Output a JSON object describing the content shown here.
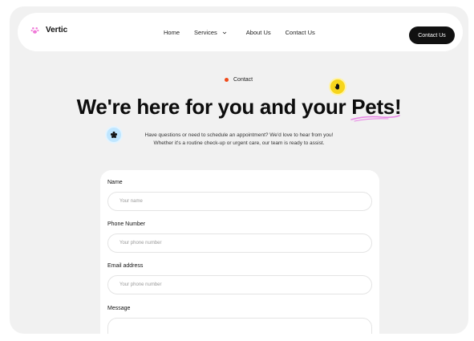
{
  "nav": {
    "brand": "Vertic",
    "links": [
      "Home",
      "Services",
      "About Us",
      "Contact Us"
    ],
    "cta_label": "Contact Us"
  },
  "hero": {
    "eyebrow": "Contact",
    "headline_before": "We're here for you and your ",
    "headline_highlight": "Pets!",
    "subtitle_line1": "Have questions or need to schedule an appointment? We'd love to hear from you!",
    "subtitle_line2": "Whether it's a routine check-up or urgent care, our team is ready to assist."
  },
  "form": {
    "name_label": "Name",
    "name_placeholder": "Your name",
    "phone_label": "Phone Number",
    "phone_placeholder": "Your phone number",
    "email_label": "Email address",
    "email_placeholder": "Your phone number",
    "message_label": "Message"
  },
  "colors": {
    "accent_dot": "#f04a1a",
    "badge_yellow": "#f7d51c",
    "badge_blue": "#bfe6ff",
    "logo_pink": "#f07ad8",
    "underline_pink": "#e889e6"
  },
  "icons": {
    "logo": "paw-icon",
    "services": "chevron-down-icon",
    "yellow_badge": "hand-icon",
    "blue_badge": "flower-icon"
  }
}
